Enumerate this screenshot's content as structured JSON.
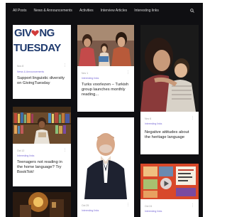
{
  "nav": {
    "items": [
      {
        "label": "All Posts"
      },
      {
        "label": "News & Announcements"
      },
      {
        "label": "Activities"
      },
      {
        "label": "Interview Articles"
      },
      {
        "label": "Interesting links"
      }
    ]
  },
  "posts": [
    {
      "image_text_line1": "GIV",
      "image_text_line1b": "NG",
      "image_text_line2": "TUESDAY",
      "meta": "Nov 8",
      "category": "News & Announcements",
      "title": "Support linguistic diversity on GivingTuesday"
    },
    {
      "meta": "Oct 12",
      "category": "Interesting links",
      "title": "Teenagers not reading in the home language? Try BookTok!"
    },
    {
      "meta": "Nov 1",
      "category": "Interesting links",
      "title": "Turks voorlezen – Turkish group launches monthly reading..."
    },
    {
      "meta": "Oct 25",
      "category": "Interesting links",
      "title": ""
    },
    {
      "meta": "Nov 6",
      "category": "Interesting links",
      "title": "Negative attitudes about the heritage language"
    },
    {
      "meta": "Oct 24",
      "category": "Interesting links",
      "title": ""
    }
  ],
  "colors": {
    "background": "#0f0f12",
    "card": "#ffffff",
    "accent": "#7a6bd6",
    "brand_red": "#d13b3b",
    "brand_blue": "#1f3a6e"
  }
}
